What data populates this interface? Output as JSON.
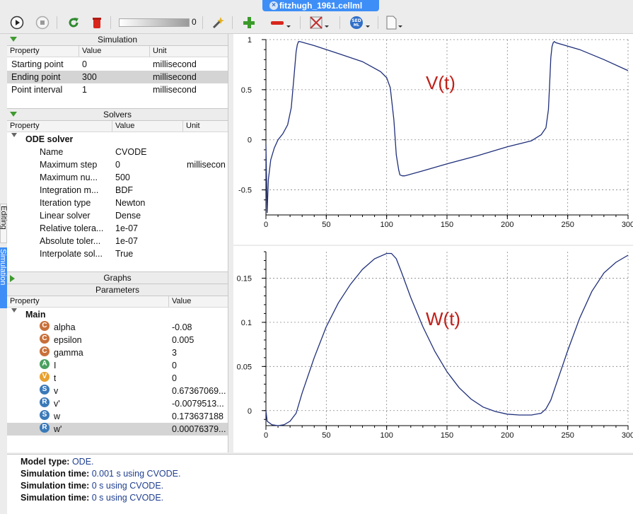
{
  "file_tab": {
    "title": "fitzhugh_1961.cellml"
  },
  "toolbar": {
    "slider_value": "0"
  },
  "side_tabs": {
    "editing": "Editing",
    "simulation": "Simulation"
  },
  "simulation": {
    "header": "Simulation",
    "columns": [
      "Property",
      "Value",
      "Unit"
    ],
    "rows": [
      {
        "property": "Starting point",
        "value": "0",
        "unit": "millisecond"
      },
      {
        "property": "Ending point",
        "value": "300",
        "unit": "millisecond"
      },
      {
        "property": "Point interval",
        "value": "1",
        "unit": "millisecond"
      }
    ]
  },
  "solvers": {
    "header": "Solvers",
    "columns": [
      "Property",
      "Value",
      "Unit"
    ],
    "group": "ODE solver",
    "rows": [
      {
        "property": "Name",
        "value": "CVODE",
        "unit": ""
      },
      {
        "property": "Maximum step",
        "value": "0",
        "unit": "millisecon"
      },
      {
        "property": "Maximum nu...",
        "value": "500",
        "unit": ""
      },
      {
        "property": "Integration m...",
        "value": "BDF",
        "unit": ""
      },
      {
        "property": "Iteration type",
        "value": "Newton",
        "unit": ""
      },
      {
        "property": "Linear solver",
        "value": "Dense",
        "unit": ""
      },
      {
        "property": "Relative tolera...",
        "value": "1e-07",
        "unit": ""
      },
      {
        "property": "Absolute toler...",
        "value": "1e-07",
        "unit": ""
      },
      {
        "property": "Interpolate sol...",
        "value": "True",
        "unit": ""
      }
    ]
  },
  "graphs_section": {
    "header": "Graphs"
  },
  "parameters": {
    "header": "Parameters",
    "columns": [
      "Property",
      "Value"
    ],
    "group": "Main",
    "rows": [
      {
        "badge": "C",
        "name": "alpha",
        "value": "-0.08"
      },
      {
        "badge": "C",
        "name": "epsilon",
        "value": "0.005"
      },
      {
        "badge": "C",
        "name": "gamma",
        "value": "3"
      },
      {
        "badge": "A",
        "name": "I",
        "value": "0"
      },
      {
        "badge": "V",
        "name": "t",
        "value": "0"
      },
      {
        "badge": "S",
        "name": "v",
        "value": "0.67367069..."
      },
      {
        "badge": "R",
        "name": "v'",
        "value": "-0.0079513..."
      },
      {
        "badge": "S",
        "name": "w",
        "value": "0.173637188"
      },
      {
        "badge": "R",
        "name": "w'",
        "value": "0.00076379..."
      }
    ]
  },
  "chart_data": [
    {
      "type": "line",
      "annotation": "V(t)",
      "color": "#1f2f7a",
      "annotation_color": "#c0201a",
      "xlim": [
        0,
        300
      ],
      "ylim": [
        -0.75,
        1
      ],
      "xticks": [
        0,
        50,
        100,
        150,
        200,
        250,
        300
      ],
      "yticks": [
        -0.5,
        0,
        0.5,
        1
      ],
      "ytick_labels": [
        "-0.5",
        "0",
        "0.5",
        "1"
      ],
      "grid": true,
      "x": [
        0,
        1,
        2,
        4,
        7,
        10,
        14,
        18,
        21,
        23,
        25,
        26,
        27,
        28,
        40,
        60,
        80,
        95,
        100,
        103,
        106,
        108,
        110,
        111,
        113,
        115,
        130,
        150,
        175,
        200,
        220,
        228,
        232,
        234,
        235,
        236,
        237,
        238,
        239,
        240,
        260,
        280,
        300
      ],
      "y": [
        -0.05,
        -0.73,
        -0.4,
        -0.2,
        -0.08,
        0.0,
        0.06,
        0.15,
        0.32,
        0.6,
        0.88,
        0.95,
        0.98,
        0.98,
        0.94,
        0.86,
        0.78,
        0.68,
        0.62,
        0.52,
        0.2,
        -0.15,
        -0.3,
        -0.35,
        -0.36,
        -0.36,
        -0.31,
        -0.24,
        -0.16,
        -0.07,
        -0.01,
        0.05,
        0.12,
        0.3,
        0.55,
        0.82,
        0.93,
        0.97,
        0.98,
        0.97,
        0.9,
        0.8,
        0.69
      ]
    },
    {
      "type": "line",
      "annotation": "W(t)",
      "color": "#1f2f7a",
      "annotation_color": "#c0201a",
      "xlim": [
        0,
        300
      ],
      "ylim": [
        -0.017,
        0.18
      ],
      "xticks": [
        0,
        50,
        100,
        150,
        200,
        250,
        300
      ],
      "yticks": [
        0,
        0.05,
        0.1,
        0.15
      ],
      "ytick_labels": [
        "0",
        "0.05",
        "0.1",
        "0.15"
      ],
      "grid": true,
      "x": [
        0,
        1,
        5,
        10,
        15,
        20,
        25,
        30,
        40,
        50,
        60,
        70,
        80,
        90,
        100,
        104,
        108,
        112,
        120,
        130,
        140,
        150,
        160,
        170,
        180,
        190,
        200,
        210,
        220,
        228,
        232,
        236,
        240,
        250,
        260,
        270,
        280,
        290,
        300
      ],
      "y": [
        0.0,
        -0.012,
        -0.016,
        -0.017,
        -0.016,
        -0.012,
        -0.003,
        0.02,
        0.06,
        0.095,
        0.122,
        0.143,
        0.16,
        0.172,
        0.178,
        0.178,
        0.172,
        0.158,
        0.128,
        0.095,
        0.067,
        0.044,
        0.026,
        0.013,
        0.004,
        -0.001,
        -0.004,
        -0.005,
        -0.005,
        -0.003,
        0.002,
        0.012,
        0.028,
        0.068,
        0.105,
        0.135,
        0.156,
        0.168,
        0.176
      ]
    }
  ],
  "output": {
    "lines": [
      {
        "label": "Model type:",
        "value": "ODE."
      },
      {
        "label": "Simulation time:",
        "value": "0.001 s using CVODE."
      },
      {
        "label": "Simulation time:",
        "value": "0 s using CVODE."
      },
      {
        "label": "Simulation time:",
        "value": "0 s using CVODE."
      }
    ]
  }
}
